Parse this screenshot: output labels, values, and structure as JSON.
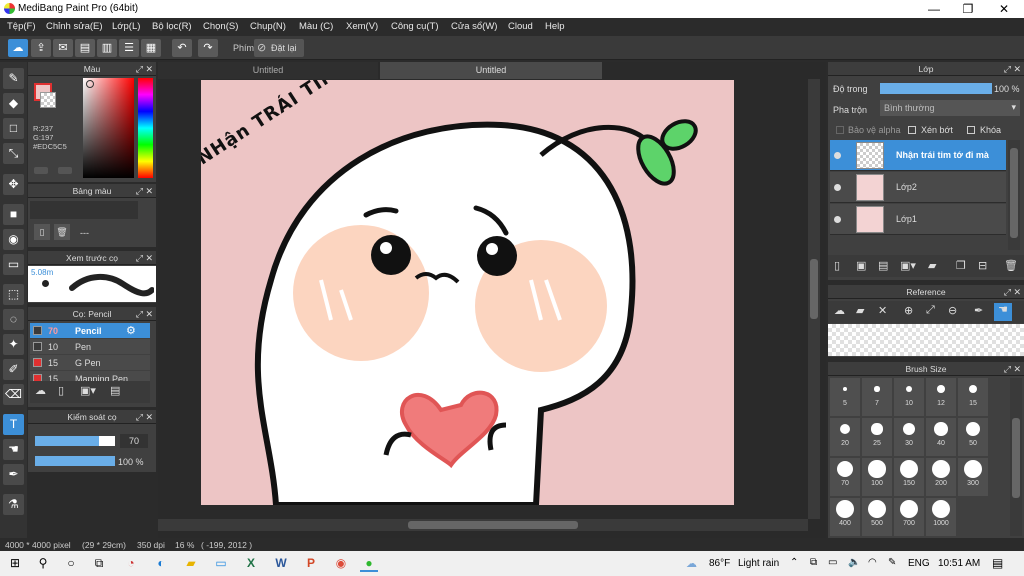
{
  "window": {
    "title": "MediBang Paint Pro (64bit)",
    "minimize": "—",
    "maximize": "❐",
    "close": "✕"
  },
  "menu": [
    "Tệp(F)",
    "Chỉnh sửa(E)",
    "Lớp(L)",
    "Bộ lọc(R)",
    "Chọn(S)",
    "Chụp(N)",
    "Màu (C)",
    "Xem(V)",
    "Công cụ(T)",
    "Cửa sổ(W)",
    "Cloud",
    "Help"
  ],
  "toolbar": {
    "shortcut_label": "Phím",
    "reset_label": "Đặt lại"
  },
  "color_panel": {
    "title": "Màu",
    "r": "R:237",
    "g": "G:197",
    "hex": "#EDC5C5",
    "fg_color": "#EDC5C5"
  },
  "palette_panel": {
    "title": "Bảng màu",
    "value": "---"
  },
  "brush_preview": {
    "title": "Xem trước cọ",
    "size": "5.08m"
  },
  "brush_panel": {
    "title": "Cọ: Pencil",
    "items": [
      {
        "size": "70",
        "name": "Pencil",
        "color": "#3a3a3a",
        "selected": true
      },
      {
        "size": "10",
        "name": "Pen",
        "color": "#3a3a3a",
        "selected": false
      },
      {
        "size": "15",
        "name": "G Pen",
        "color": "#e03030",
        "selected": false
      },
      {
        "size": "15",
        "name": "Mapping Pen",
        "color": "#e03030",
        "selected": false
      }
    ]
  },
  "brush_control": {
    "title": "Kiểm soát cọ",
    "size": "70",
    "opacity": "100 %",
    "size_level": 0.8,
    "opacity_level": 1.0
  },
  "tabs": [
    "Untitled",
    "Untitled"
  ],
  "artwork": {
    "text": "NHận TRÁI TIM Tớ ĐI MÀ",
    "bg": "#EDC5C5"
  },
  "status": {
    "size": "4000 * 4000 pixel",
    "cm": "(29 * 29cm)",
    "dpi": "350 dpi",
    "zoom": "16 %",
    "coords": "( -199, 2012 )"
  },
  "layer_panel": {
    "title": "Lớp",
    "opacity_label": "Độ trong",
    "opacity_value": "100 %",
    "opacity_level": 1.0,
    "blend_label": "Pha trộn",
    "blend_value": "Bình thường",
    "protect_alpha": "Bảo vệ alpha",
    "clipping": "Xén bớt",
    "lock": "Khóa",
    "layers": [
      {
        "name": "Nhận trái tim tớ đi mà",
        "selected": true
      },
      {
        "name": "Lớp2",
        "selected": false
      },
      {
        "name": "Lớp1",
        "selected": false
      }
    ]
  },
  "reference_panel": {
    "title": "Reference"
  },
  "brush_size_panel": {
    "title": "Brush Size",
    "sizes": [
      "5",
      "7",
      "10",
      "12",
      "15",
      "20",
      "25",
      "30",
      "40",
      "50",
      "70",
      "100",
      "150",
      "200",
      "300",
      "400",
      "500",
      "700",
      "1000"
    ]
  },
  "taskbar": {
    "weather_temp": "86°F",
    "weather_text": "Light rain",
    "lang": "ENG",
    "time": "10:51 AM"
  }
}
